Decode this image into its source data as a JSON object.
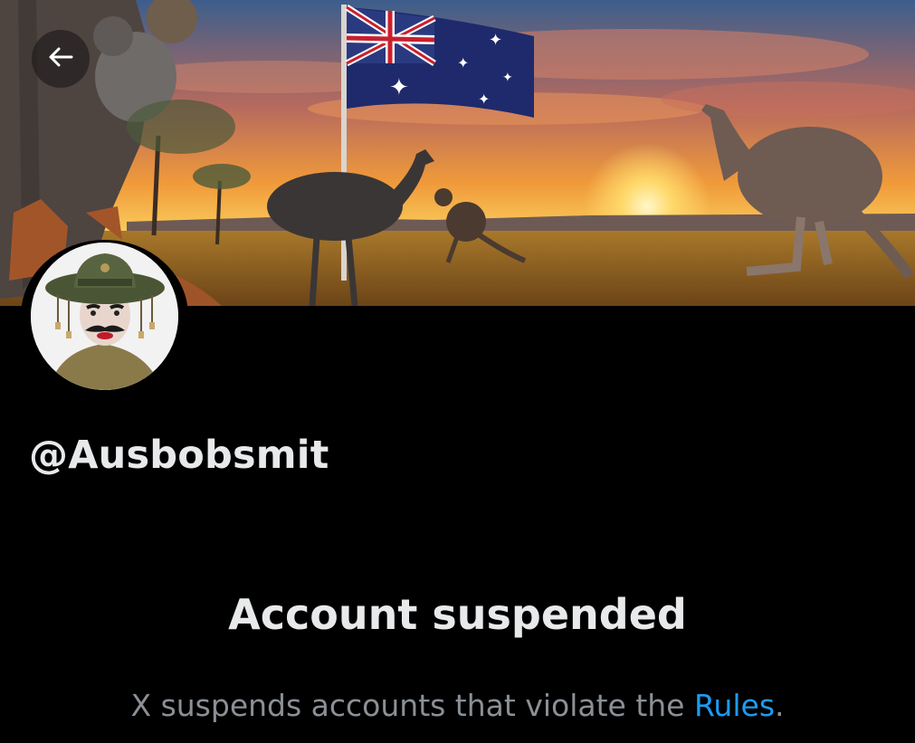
{
  "header": {
    "back_icon": "arrow-left-icon"
  },
  "banner": {
    "description_icon": "australian-outback-banner-image"
  },
  "profile": {
    "avatar_icon": "profile-avatar",
    "handle": "@Ausbobsmit"
  },
  "suspension": {
    "title": "Account suspended",
    "message_prefix": "X suspends accounts that violate the ",
    "rules_link": "Rules",
    "message_suffix": "."
  },
  "colors": {
    "background": "#000000",
    "text_primary": "#e7e9ea",
    "text_secondary": "#8b9096",
    "link": "#1d9bf0"
  }
}
